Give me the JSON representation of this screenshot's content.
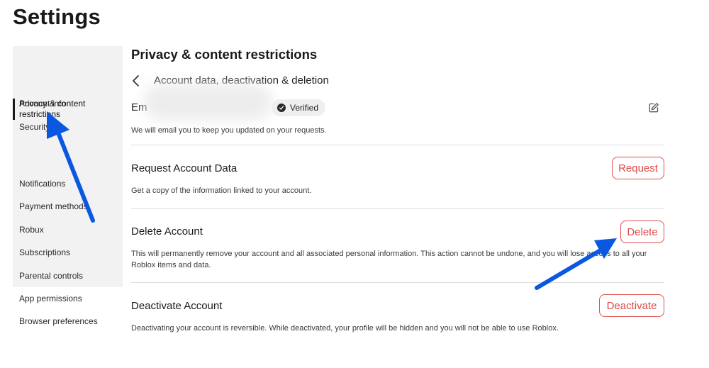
{
  "page": {
    "title": "Settings"
  },
  "sidebar": {
    "items": [
      {
        "label": "Account info",
        "active": false
      },
      {
        "label": "Security",
        "active": false
      },
      {
        "label": "Privacy & content restrictions",
        "active": true
      },
      {
        "label": "Notifications",
        "active": false
      },
      {
        "label": "Payment methods",
        "active": false
      },
      {
        "label": "Robux",
        "active": false
      },
      {
        "label": "Subscriptions",
        "active": false
      },
      {
        "label": "Parental controls",
        "active": false
      },
      {
        "label": "App permissions",
        "active": false
      },
      {
        "label": "Browser preferences",
        "active": false
      }
    ]
  },
  "main": {
    "section_title": "Privacy & content restrictions",
    "back_icon": "chevron-left-icon",
    "subpage_title": "Account data, deactivation & deletion",
    "email": {
      "label": "Em",
      "badge": "Verified",
      "badge_icon": "check-circle-icon",
      "edit_icon": "edit-icon",
      "description": "We will email you to keep you updated on your requests."
    },
    "request": {
      "title": "Request Account Data",
      "button": "Request",
      "description": "Get a copy of the information linked to your account."
    },
    "delete": {
      "title": "Delete Account",
      "button": "Delete",
      "description": "This will permanently remove your account and all associated personal information. This action cannot be undone, and you will lose access to all your Roblox items and data."
    },
    "deactivate": {
      "title": "Deactivate Account",
      "button": "Deactivate",
      "description": "Deactivating your account is reversible. While deactivated, your profile will be hidden and you will not be able to use Roblox."
    }
  },
  "colors": {
    "accent_red": "#e04848",
    "annotation_blue": "#0a57e0",
    "sidebar_bg": "#f2f2f3"
  }
}
